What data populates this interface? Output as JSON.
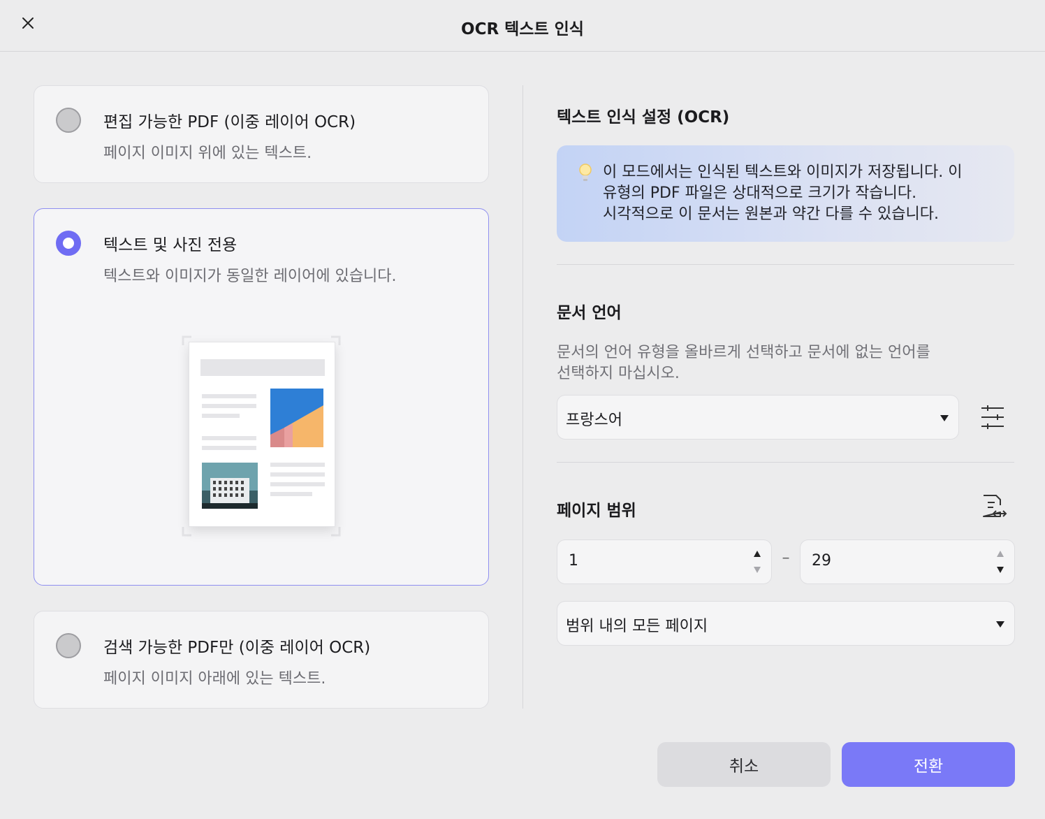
{
  "window": {
    "title": "OCR 텍스트 인식"
  },
  "options": [
    {
      "title": "편집 가능한 PDF (이중 레이어 OCR)",
      "desc": "페이지 이미지 위에 있는 텍스트.",
      "selected": false
    },
    {
      "title": "텍스트 및 사진 전용",
      "desc": "텍스트와 이미지가 동일한 레이어에 있습니다.",
      "selected": true
    },
    {
      "title": "검색 가능한 PDF만 (이중 레이어 OCR)",
      "desc": "페이지 이미지 아래에 있는 텍스트.",
      "selected": false
    }
  ],
  "settings": {
    "title": "텍스트 인식 설정 (OCR)",
    "info_lines": [
      "이 모드에서는 인식된 텍스트와 이미지가 저장됩니다. 이",
      "유형의 PDF 파일은 상대적으로 크기가 작습니다.",
      "시각적으로 이 문서는 원본과 약간 다를 수 있습니다."
    ]
  },
  "language": {
    "title": "문서 언어",
    "help_lines": [
      "문서의 언어 유형을 올바르게 선택하고 문서에 없는 언어를",
      "선택하지 마십시오."
    ],
    "selected": "프랑스어"
  },
  "page_range": {
    "title": "페이지 범위",
    "from": "1",
    "to": "29",
    "dash": "–",
    "mode": "범위 내의 모든 페이지"
  },
  "buttons": {
    "cancel": "취소",
    "convert": "전환"
  },
  "colors": {
    "accent": "#7a79f7",
    "selected_border": "#8f8ff0"
  }
}
